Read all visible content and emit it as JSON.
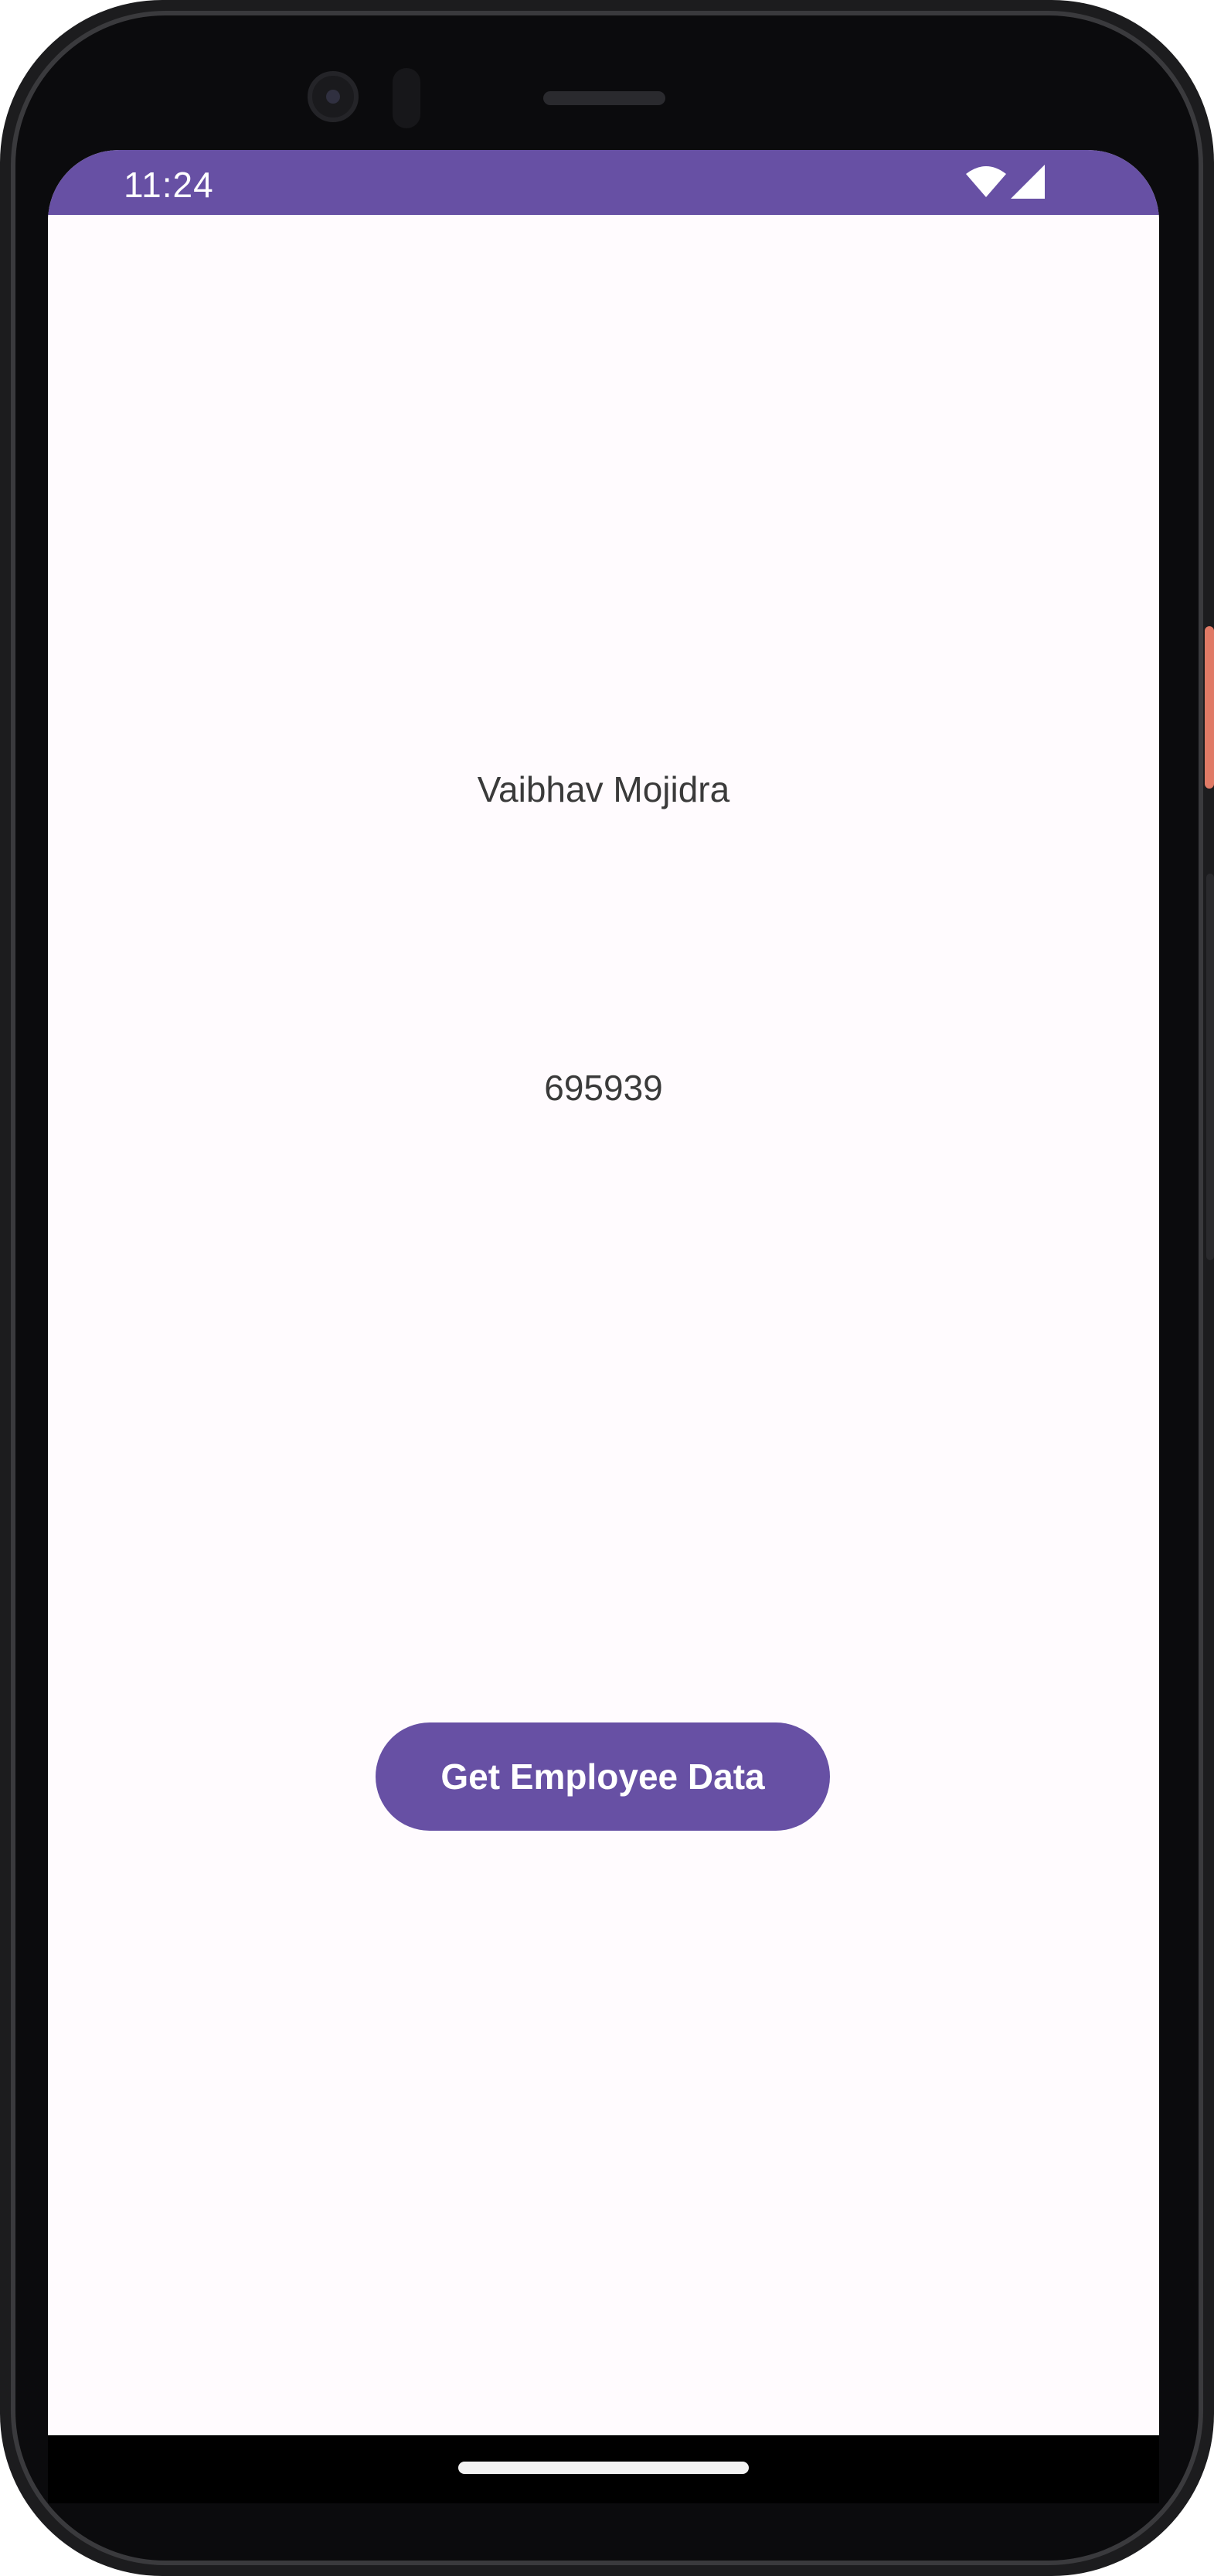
{
  "status_bar": {
    "time": "11:24",
    "background_color": "#6750a4",
    "icons": [
      "wifi-icon",
      "cellular-signal-icon"
    ]
  },
  "employee": {
    "name": "Vaibhav Mojidra",
    "id": "695939"
  },
  "actions": {
    "get_data_label": "Get Employee Data",
    "button_color": "#6750a4"
  },
  "theme": {
    "screen_background": "#fffbfe",
    "text_color": "#3a3a3a"
  }
}
